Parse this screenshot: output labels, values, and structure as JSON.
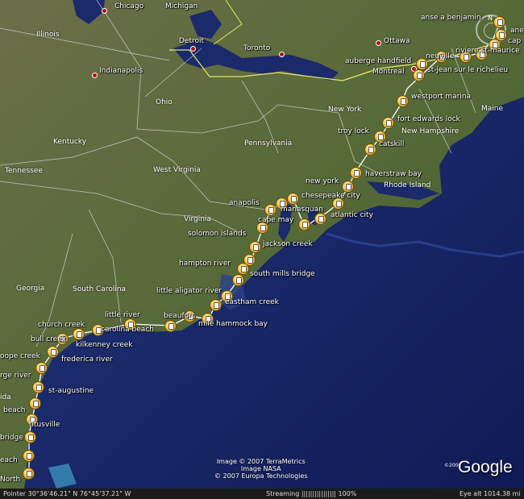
{
  "places": {
    "chicago": "Chicago",
    "michigan": "Michigan",
    "illinois": "Illinois",
    "indianapolis": "Indianapolis",
    "detroit": "Detroit",
    "toronto": "Toronto",
    "ottawa": "Ottawa",
    "montreal": "Montreal",
    "ohio": "Ohio",
    "new_york": "New York",
    "maine": "Maine",
    "new_hampshire": "New Hampshire",
    "kentucky": "Kentucky",
    "pennsylvania": "Pennsylvania",
    "tennessee": "Tennessee",
    "west_virginia": "West Virginia",
    "virginia": "Virginia",
    "rhode_island": "Rhode Island",
    "georgia": "Georgia",
    "south_carolina": "South Carolina",
    "florida_partial": "ida"
  },
  "stops": [
    "anse a benjamin",
    "cap",
    "ane",
    "riviere st-maurice",
    "neuville",
    "auberge handfield",
    "st-jean sur le richelieu",
    "westport marina",
    "fort edwards lock",
    "troy lock",
    "catskill",
    "haverstraw bay",
    "new york",
    "chesepeake city",
    "anapolis",
    "manasquan",
    "atlantic city",
    "cape may",
    "solomon islands",
    "jackson creek",
    "hampton river",
    "south mills bridge",
    "little aligator river",
    "eastham creek",
    "little river",
    "beaufort",
    "mile hammock bay",
    "carolina beach",
    "church creek",
    "bull creek",
    "kilkenney creek",
    "frederica river",
    "oope creek",
    "rge river",
    "st-augustine",
    "beach",
    "titusville",
    "bridge",
    "each",
    "North"
  ],
  "credits": [
    "Image © 2007 TerraMetrics",
    "Image NASA",
    "© 2007 Europa Technologies"
  ],
  "logo": "Google",
  "logo_copyright": "©2006",
  "status": {
    "pointer": "Pointer  30°36'46.21\"  N     76°45'37.21\"  W",
    "streaming": "Streaming  ||||||||||||||||  100%",
    "eye_alt": "Eye alt  1014.38 mi"
  },
  "colors": {
    "ocean": "#1a2a6b",
    "land": "#5b6a3c",
    "marker": "#f3c24b",
    "route": "#ffffff"
  }
}
